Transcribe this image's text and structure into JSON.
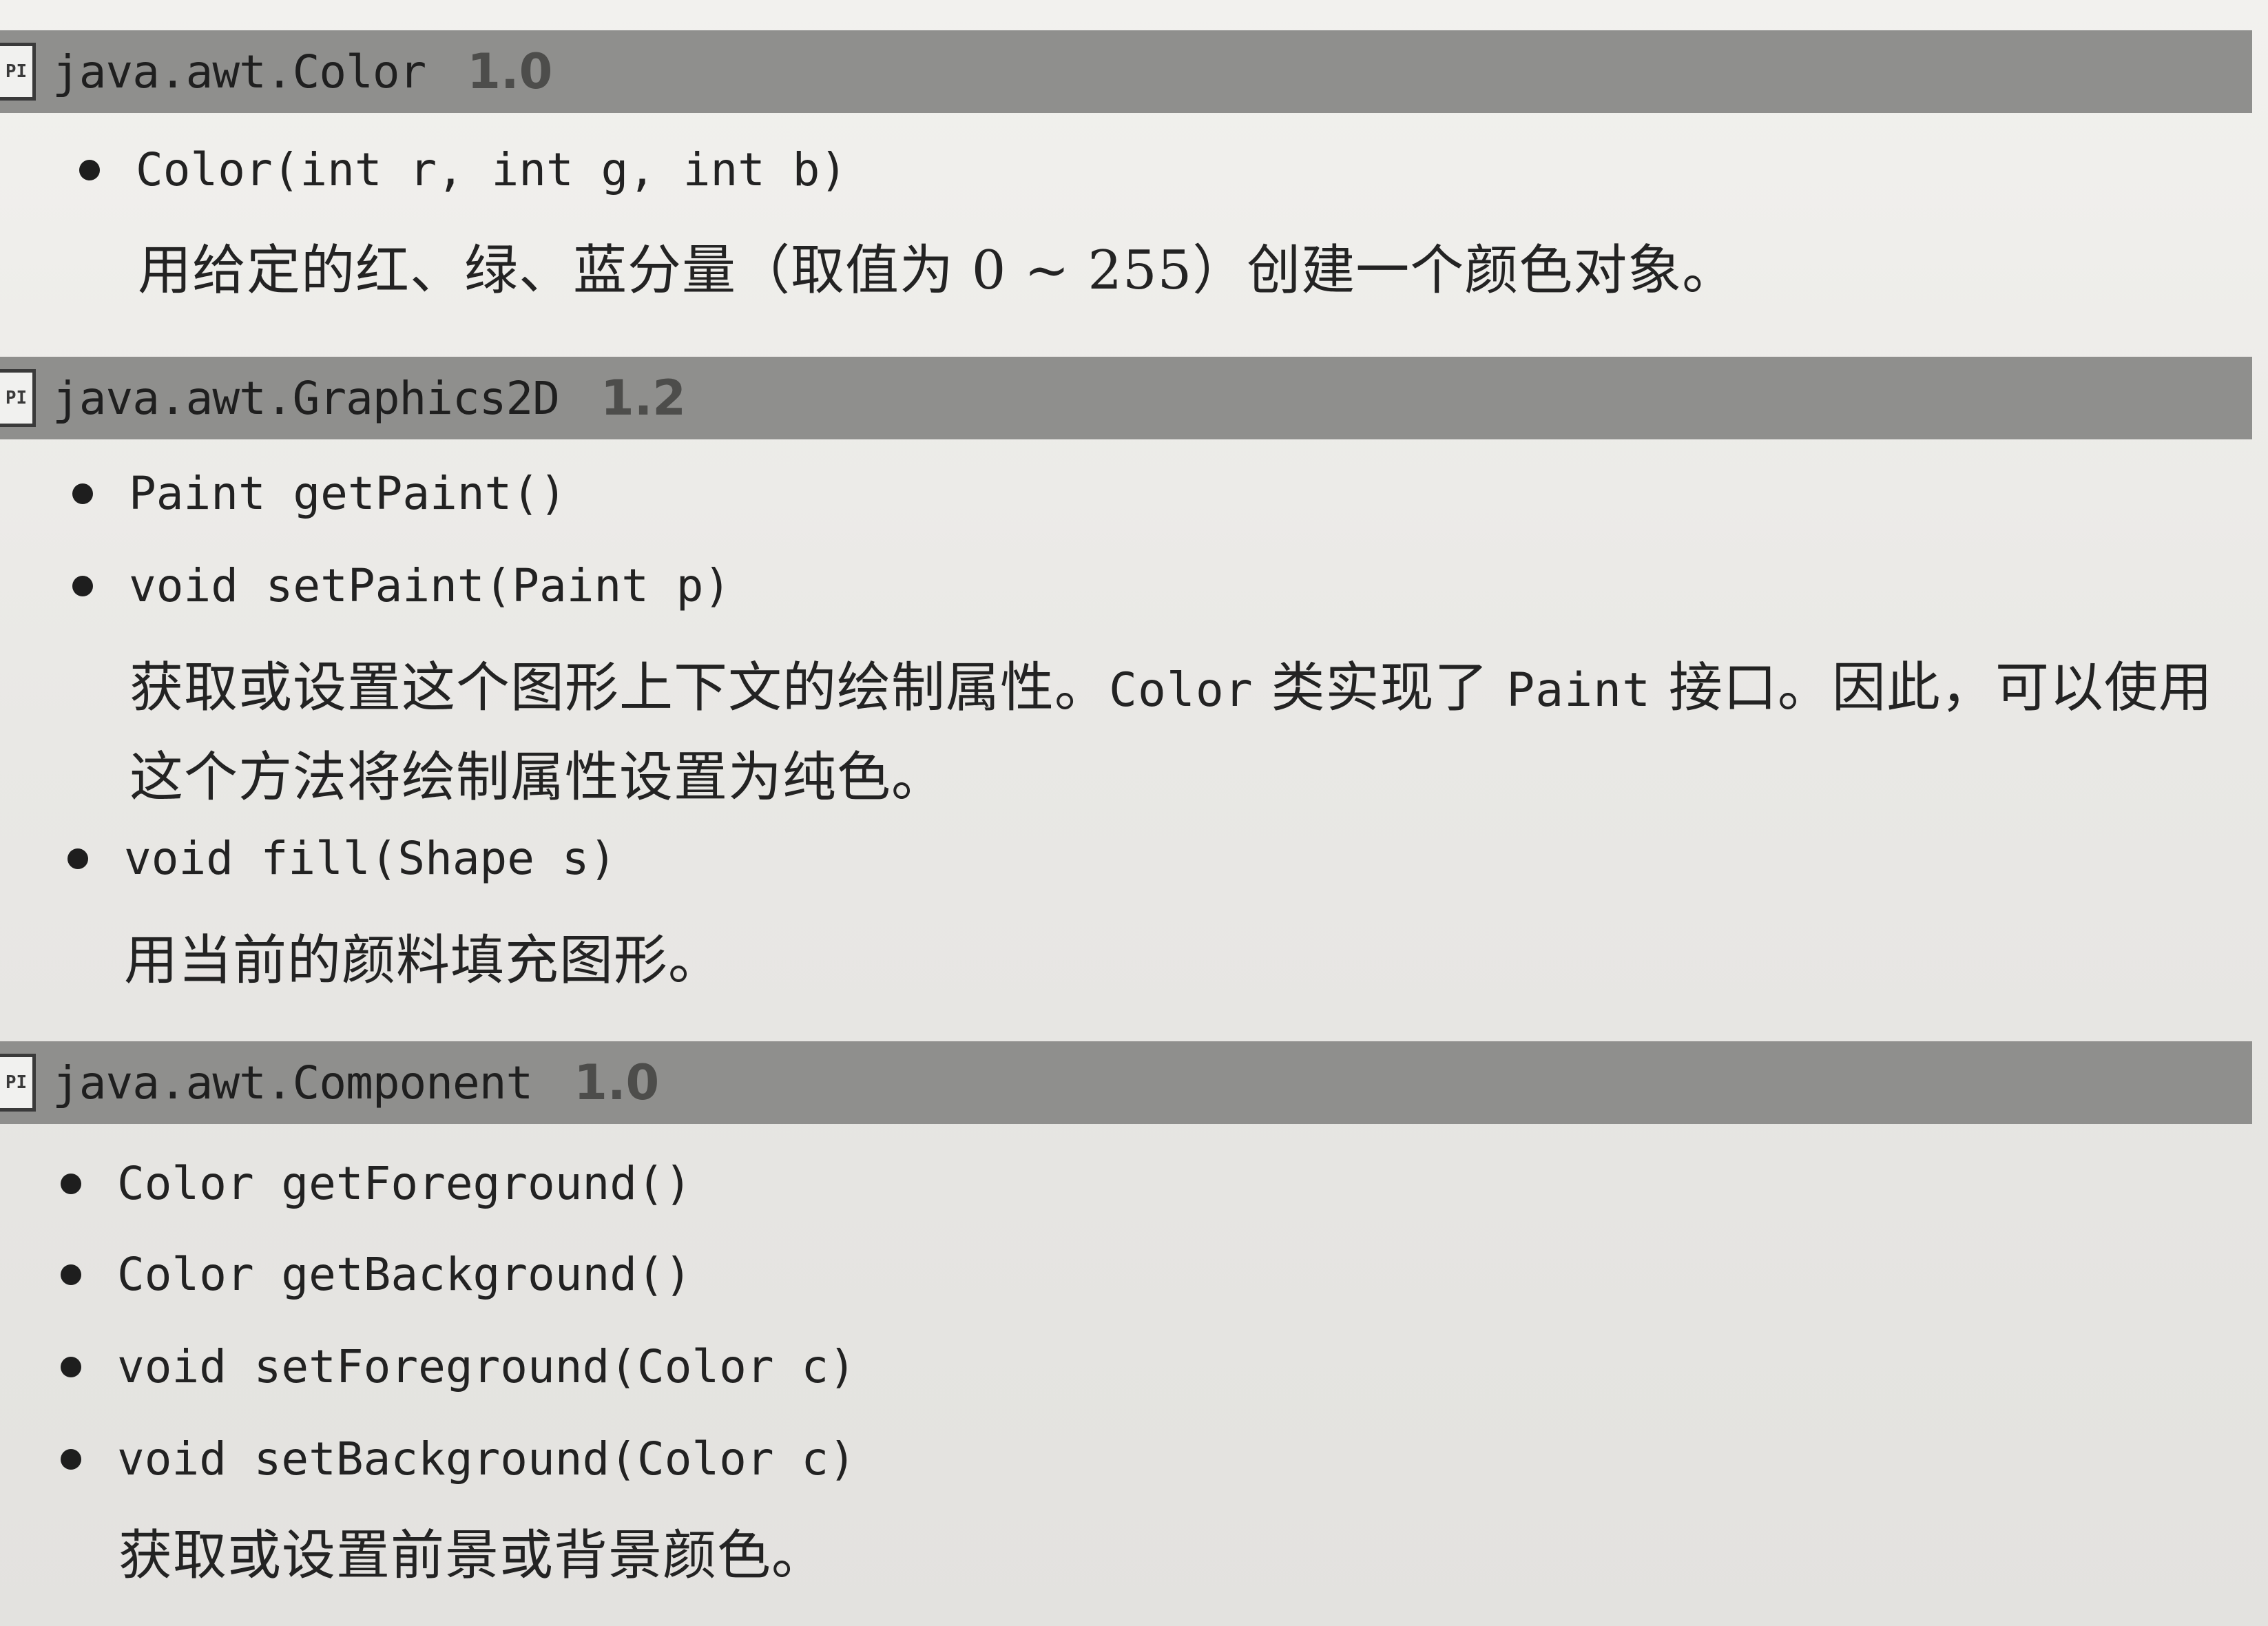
{
  "sections": [
    {
      "tag": "PI",
      "class_name": "java.awt.Color",
      "version": "1.0",
      "methods": [
        "Color(int r, int g, int b)"
      ],
      "description": "用给定的红、绿、蓝分量（取值为 0 ~ 255）创建一个颜色对象。"
    },
    {
      "tag": "PI",
      "class_name": "java.awt.Graphics2D",
      "version": "1.2",
      "methods": [
        "Paint getPaint()",
        "void setPaint(Paint p)",
        "void fill(Shape s)"
      ],
      "description_1a": "获取或设置这个图形上下文的绘制属性。",
      "description_1b": "Color",
      "description_1c": "类实现了",
      "description_1d": "Paint",
      "description_1e": "接口。因此，可以使用",
      "description_2": "这个方法将绘制属性设置为纯色。",
      "description_3": "用当前的颜料填充图形。"
    },
    {
      "tag": "PI",
      "class_name": "java.awt.Component",
      "version": "1.0",
      "methods": [
        "Color getForeground()",
        "Color getBackground()",
        "void setForeground(Color c)",
        "void setBackground(Color c)"
      ],
      "description": "获取或设置前景或背景颜色。"
    }
  ]
}
